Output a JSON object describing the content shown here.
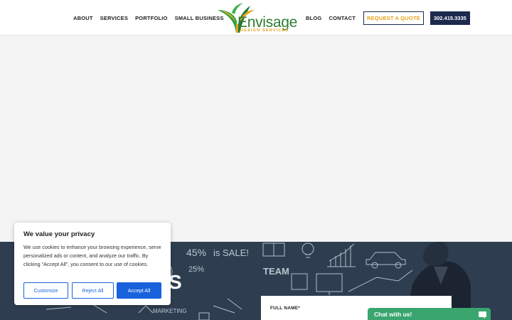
{
  "header": {
    "nav_left": [
      "ABOUT",
      "SERVICES",
      "PORTFOLIO",
      "SMALL BUSINESS"
    ],
    "nav_right": [
      "BLOG",
      "CONTACT"
    ],
    "quote_label": "REQUEST A QUOTE",
    "phone_label": "302.415.3335",
    "logo": {
      "name": "Envisage",
      "sub": "DESIGN SERVICES"
    }
  },
  "board": {
    "chalk_words": [
      "45%",
      "is SALE!",
      "25%",
      "TEAM",
      "MARKETING"
    ],
    "partial_heading": "S"
  },
  "form": {
    "full_name_label": "FULL NAME*"
  },
  "chat": {
    "label": "Chat with us!"
  },
  "cookie": {
    "title": "We value your privacy",
    "text": "We use cookies to enhance your browsing experience, serve personalized ads or content, and analyze our traffic. By clicking \"Accept All\", you consent to our use of cookies.",
    "customize": "Customize",
    "reject": "Reject All",
    "accept": "Accept All"
  },
  "colors": {
    "navy": "#1c2a4d",
    "gold": "#e8a21b",
    "green": "#2e7d32",
    "blue": "#1863dc",
    "chat_green": "#3aa56f"
  }
}
